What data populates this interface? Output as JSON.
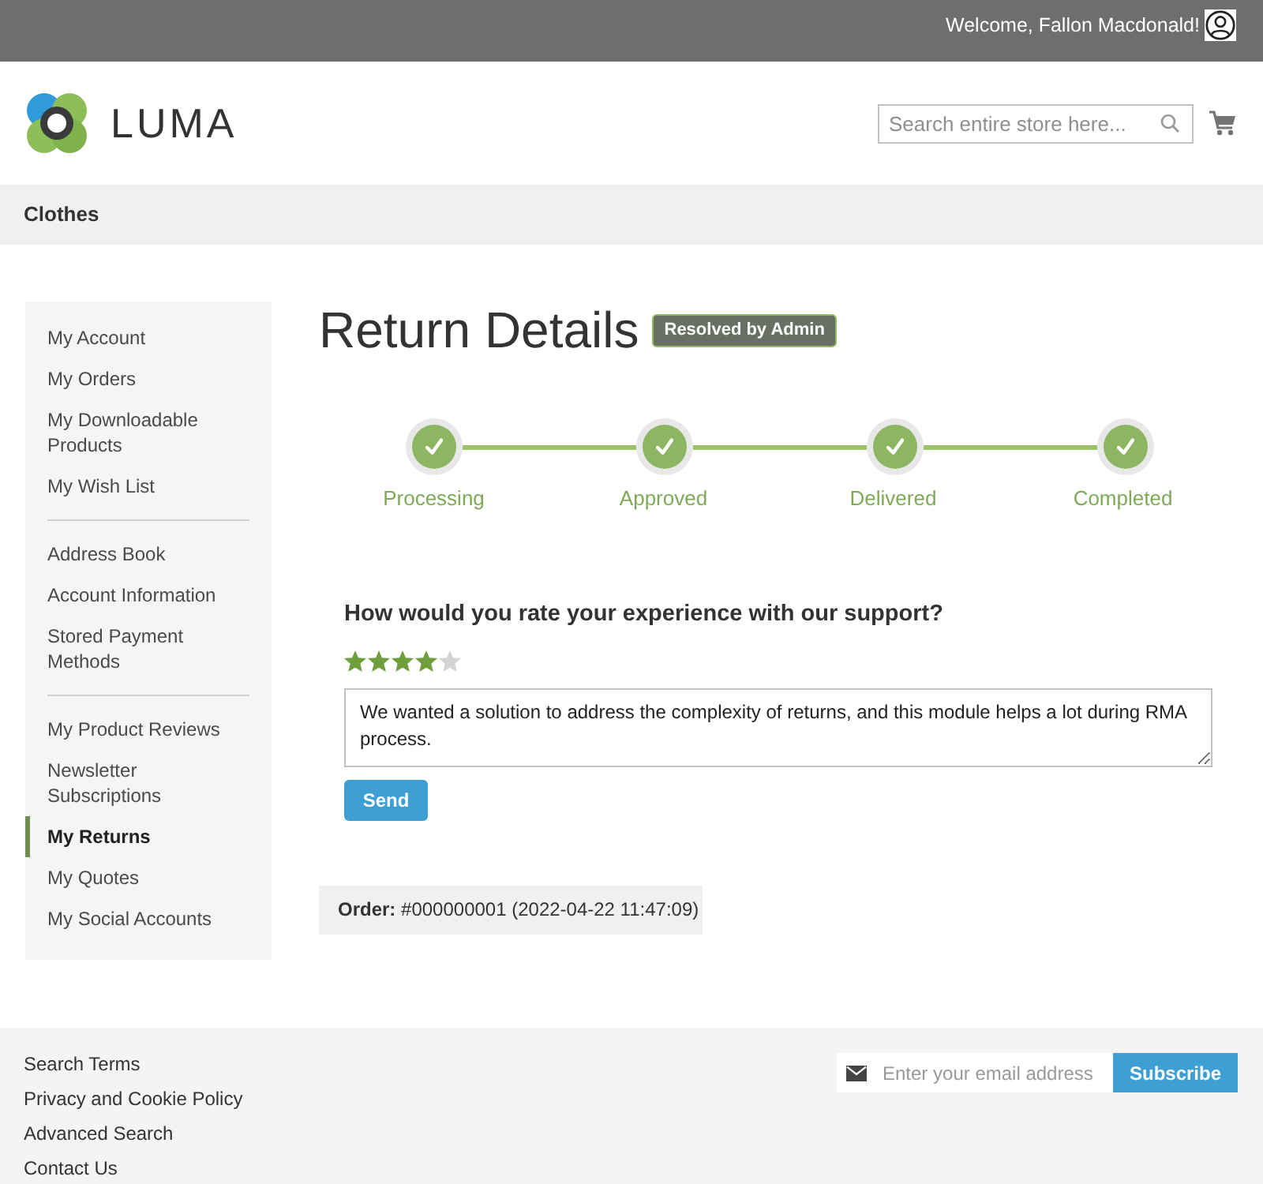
{
  "top_bar": {
    "welcome": "Welcome, Fallon Macdonald!"
  },
  "header": {
    "logo": "LUMA",
    "search": {
      "placeholder": "Search entire store here..."
    }
  },
  "nav": {
    "items": [
      {
        "label": "Clothes"
      }
    ]
  },
  "sidebar": {
    "sections": [
      {
        "items": [
          {
            "label": "My Account",
            "selected": false
          },
          {
            "label": "My Orders",
            "selected": false
          },
          {
            "label": "My Downloadable Products",
            "selected": false
          },
          {
            "label": "My Wish List",
            "selected": false
          }
        ]
      },
      {
        "items": [
          {
            "label": "Address Book",
            "selected": false
          },
          {
            "label": "Account Information",
            "selected": false
          },
          {
            "label": "Stored Payment Methods",
            "selected": false
          }
        ]
      },
      {
        "items": [
          {
            "label": "My Product Reviews",
            "selected": false
          },
          {
            "label": "Newsletter Subscriptions",
            "selected": false
          },
          {
            "label": "My Returns",
            "selected": true
          },
          {
            "label": "My Quotes",
            "selected": false
          },
          {
            "label": "My Social Accounts",
            "selected": false
          }
        ]
      }
    ]
  },
  "page_title": "Return Details",
  "status_badge": "Resolved by Admin",
  "progress": {
    "steps": [
      {
        "label": "Processing",
        "done": true
      },
      {
        "label": "Approved",
        "done": true
      },
      {
        "label": "Delivered",
        "done": true
      },
      {
        "label": "Completed",
        "done": true
      }
    ]
  },
  "rating": {
    "question": "How would you rate your experience with our support?",
    "stars": 4
  },
  "comment": {
    "value": "We wanted a solution to address the complexity of returns, and this module helps a lot during RMA process."
  },
  "send_button": "Send",
  "order": "**Order:** #000000001 (2022-04-22 11:47:09)",
  "footer": {
    "links": [
      "Search Terms",
      "Privacy and Cookie Policy",
      "Advanced Search",
      "Contact Us"
    ],
    "newsletter": {
      "placeholder": "Enter your email address",
      "button": "Subscribe"
    }
  }
}
